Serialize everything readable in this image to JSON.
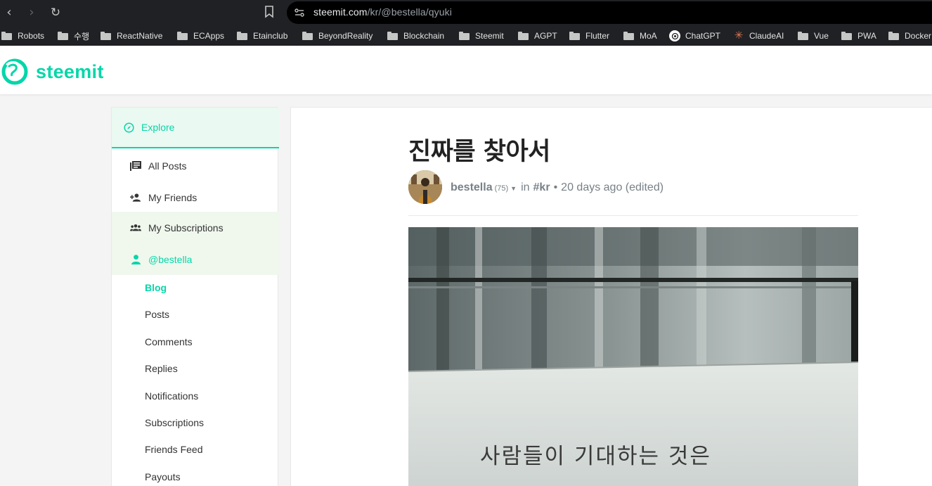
{
  "browser": {
    "url_domain": "steemit.com",
    "url_path": "/kr/@bestella/qyuki",
    "bookmarks": [
      {
        "label": "Robots",
        "icon": "folder-icon"
      },
      {
        "label": "수행",
        "icon": "folder-icon"
      },
      {
        "label": "ReactNative",
        "icon": "folder-icon"
      },
      {
        "label": "ECApps",
        "icon": "folder-icon"
      },
      {
        "label": "Etainclub",
        "icon": "folder-icon"
      },
      {
        "label": "BeyondReality",
        "icon": "folder-icon"
      },
      {
        "label": "Blockchain",
        "icon": "folder-icon"
      },
      {
        "label": "Steemit",
        "icon": "folder-icon"
      },
      {
        "label": "AGPT",
        "icon": "folder-icon"
      },
      {
        "label": "Flutter",
        "icon": "folder-icon"
      },
      {
        "label": "MoA",
        "icon": "folder-icon"
      },
      {
        "label": "ChatGPT",
        "icon": "chatgpt-icon"
      },
      {
        "label": "ClaudeAI",
        "icon": "claude-icon"
      },
      {
        "label": "Vue",
        "icon": "folder-icon"
      },
      {
        "label": "PWA",
        "icon": "folder-icon"
      },
      {
        "label": "Docker",
        "icon": "folder-icon"
      }
    ]
  },
  "header": {
    "logo_text": "steemit",
    "brand_color": "#06d6a9"
  },
  "sidebar": {
    "explore_label": "Explore",
    "items": [
      {
        "label": "All Posts",
        "icon": "list-icon"
      },
      {
        "label": "My Friends",
        "icon": "friends-icon"
      },
      {
        "label": "My Subscriptions",
        "icon": "group-icon"
      },
      {
        "label": "@bestella",
        "icon": "user-icon"
      }
    ],
    "sub_items": [
      {
        "label": "Blog",
        "active": true
      },
      {
        "label": "Posts"
      },
      {
        "label": "Comments"
      },
      {
        "label": "Replies"
      },
      {
        "label": "Notifications"
      },
      {
        "label": "Subscriptions"
      },
      {
        "label": "Friends Feed"
      },
      {
        "label": "Payouts"
      }
    ]
  },
  "post": {
    "title": "진짜를 찾아서",
    "author": "bestella",
    "reputation": "(75)",
    "in_label": "in",
    "tag": "#kr",
    "separator": "•",
    "time": "20 days ago (edited)",
    "image_text": "사람들이 기대하는 것은"
  }
}
